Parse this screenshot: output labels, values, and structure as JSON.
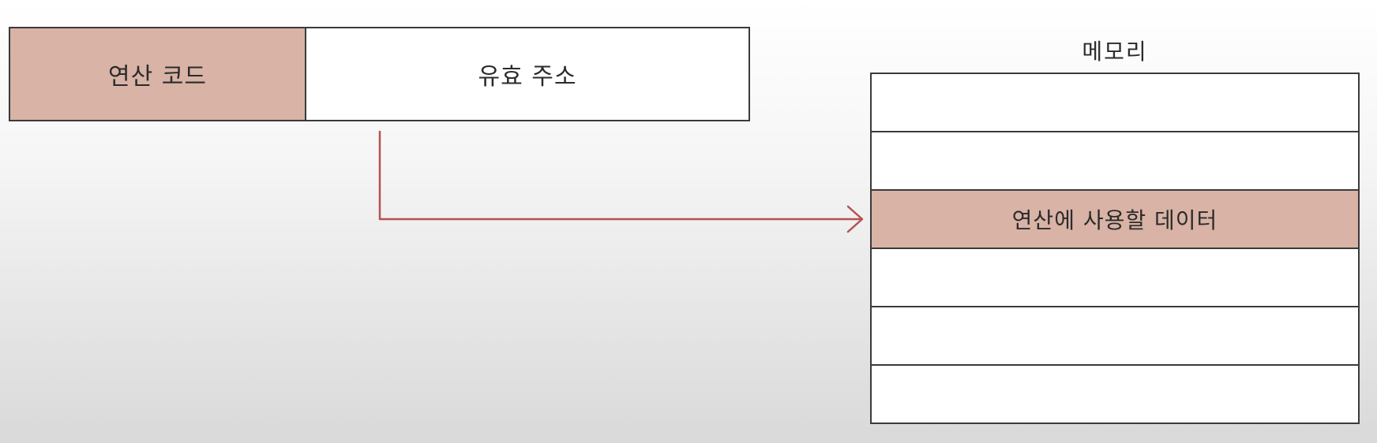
{
  "instruction": {
    "opcode_label": "연산 코드",
    "address_label": "유효 주소"
  },
  "memory": {
    "title": "메모리",
    "cells": [
      "",
      "",
      "연산에 사용할 데이터",
      "",
      "",
      ""
    ],
    "highlight_index": 2
  },
  "colors": {
    "highlight": "#d8b3a6",
    "arrow": "#b5524f",
    "border": "#3a3a3a"
  }
}
